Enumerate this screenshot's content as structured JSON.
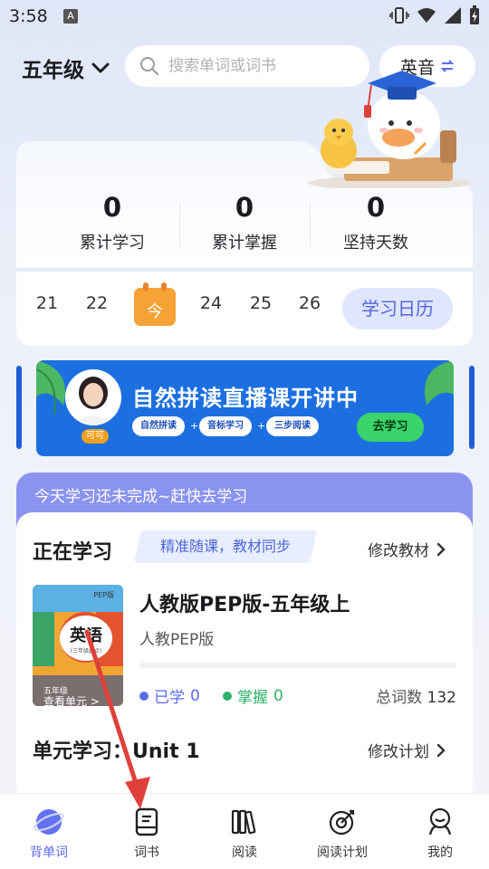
{
  "status_bar": {
    "time": "3:58",
    "notif_letter": "A"
  },
  "header": {
    "grade": "五年级",
    "search_placeholder": "搜索单词或词书",
    "accent_label": "英音"
  },
  "stats": [
    {
      "value": "0",
      "label": "累计学习"
    },
    {
      "value": "0",
      "label": "累计掌握"
    },
    {
      "value": "0",
      "label": "坚持天数"
    }
  ],
  "calendar": {
    "days": [
      "21",
      "22",
      "24",
      "25",
      "26"
    ],
    "today_label": "今",
    "calendar_button": "学习日历"
  },
  "banner": {
    "title": "自然拼读直播课开讲中",
    "steps": [
      "自然拼读",
      "音标学习",
      "三步阅读"
    ],
    "button": "去学习",
    "teacher_name": "可可"
  },
  "learning": {
    "notice": "今天学习还未完成~赶快去学习",
    "current_title": "正在学习",
    "tag": "精准随课，教材同步",
    "modify_book": "修改教材",
    "book": {
      "cover_badge": "PEP版",
      "cover_subject": "英语",
      "cover_sub": "(三年级起点)",
      "cover_grade": "五年级",
      "cover_action": "查看单元 >",
      "title": "人教版PEP版-五年级上",
      "publisher": "人教PEP版",
      "progress": 0
    },
    "learned_label": "已学",
    "learned_count": "0",
    "mastered_label": "掌握",
    "mastered_count": "0",
    "total_label": "总词数",
    "total_count": "132",
    "unit_title": "单元学习：Unit 1",
    "modify_plan": "修改计划"
  },
  "tabs": [
    {
      "label": "背单词",
      "icon": "planet-icon",
      "active": true
    },
    {
      "label": "词书",
      "icon": "book-icon",
      "active": false
    },
    {
      "label": "阅读",
      "icon": "books-icon",
      "active": false
    },
    {
      "label": "阅读计划",
      "icon": "target-icon",
      "active": false
    },
    {
      "label": "我的",
      "icon": "profile-icon",
      "active": false
    }
  ],
  "colors": {
    "accent": "#5b6bea",
    "today": "#f6a235",
    "banner": "#1c6fe0",
    "learned_dot": "#5b6bea",
    "mastered_dot": "#2fb36b",
    "annotation": "#e0403a"
  }
}
